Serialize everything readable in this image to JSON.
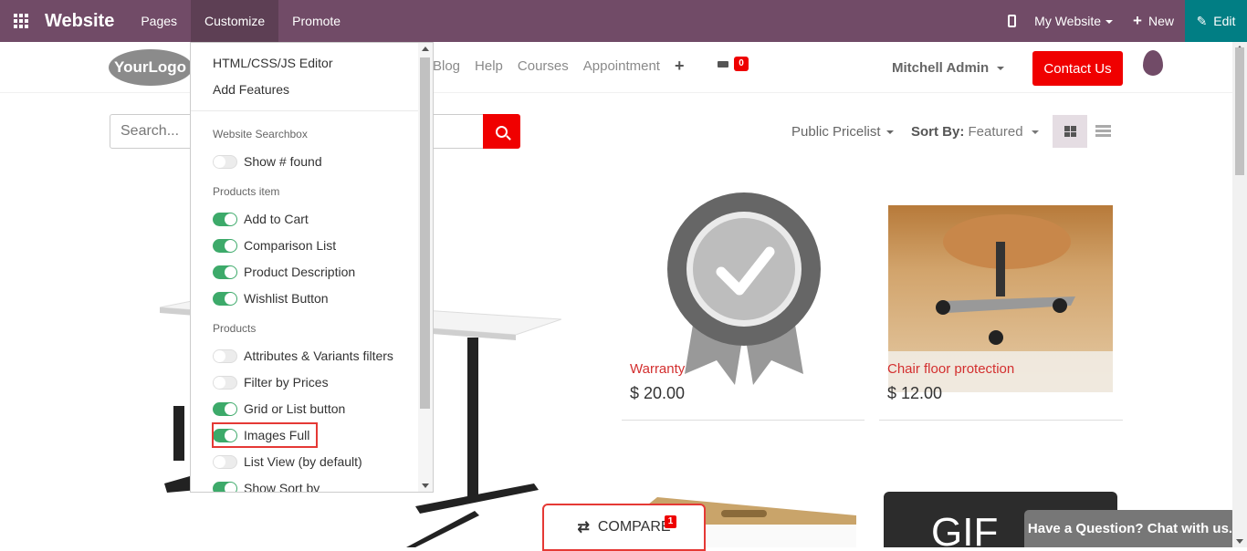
{
  "topbar": {
    "brand": "Website",
    "menus": [
      "Pages",
      "Customize",
      "Promote"
    ],
    "site_selector": "My Website",
    "new_label": "New",
    "edit_label": "Edit",
    "bg_color": "#714b67",
    "edit_color": "#017e84"
  },
  "site_nav": {
    "logo_text": "YourLogo",
    "links": [
      "Blog",
      "Help",
      "Courses",
      "Appointment"
    ],
    "cart_count": "0",
    "user": "Mitchell Admin",
    "contact_label": "Contact Us"
  },
  "search": {
    "placeholder": "Search..."
  },
  "filters": {
    "pricelist": "Public Pricelist",
    "sort_label": "Sort By:",
    "sort_value": "Featured"
  },
  "customize_menu": {
    "editor": "HTML/CSS/JS Editor",
    "add_features": "Add Features",
    "sections": [
      {
        "title": "Website Searchbox",
        "options": [
          {
            "label": "Show # found",
            "on": false
          }
        ]
      },
      {
        "title": "Products item",
        "options": [
          {
            "label": "Add to Cart",
            "on": true
          },
          {
            "label": "Comparison List",
            "on": true
          },
          {
            "label": "Product Description",
            "on": true
          },
          {
            "label": "Wishlist Button",
            "on": true
          }
        ]
      },
      {
        "title": "Products",
        "options": [
          {
            "label": "Attributes & Variants filters",
            "on": false
          },
          {
            "label": "Filter by Prices",
            "on": false
          },
          {
            "label": "Grid or List button",
            "on": true
          },
          {
            "label": "Images Full",
            "on": true
          },
          {
            "label": "List View (by default)",
            "on": false
          },
          {
            "label": "Show Sort by",
            "on": true
          }
        ]
      }
    ]
  },
  "products": [
    {
      "name": "Warranty",
      "price": "$ 20.00"
    },
    {
      "name": "Chair floor protection",
      "price": "$ 12.00"
    }
  ],
  "compare": {
    "label": "COMPARE",
    "count": "1"
  },
  "chat": {
    "label": "Have a Question? Chat with us."
  },
  "gift_text": "GIF"
}
